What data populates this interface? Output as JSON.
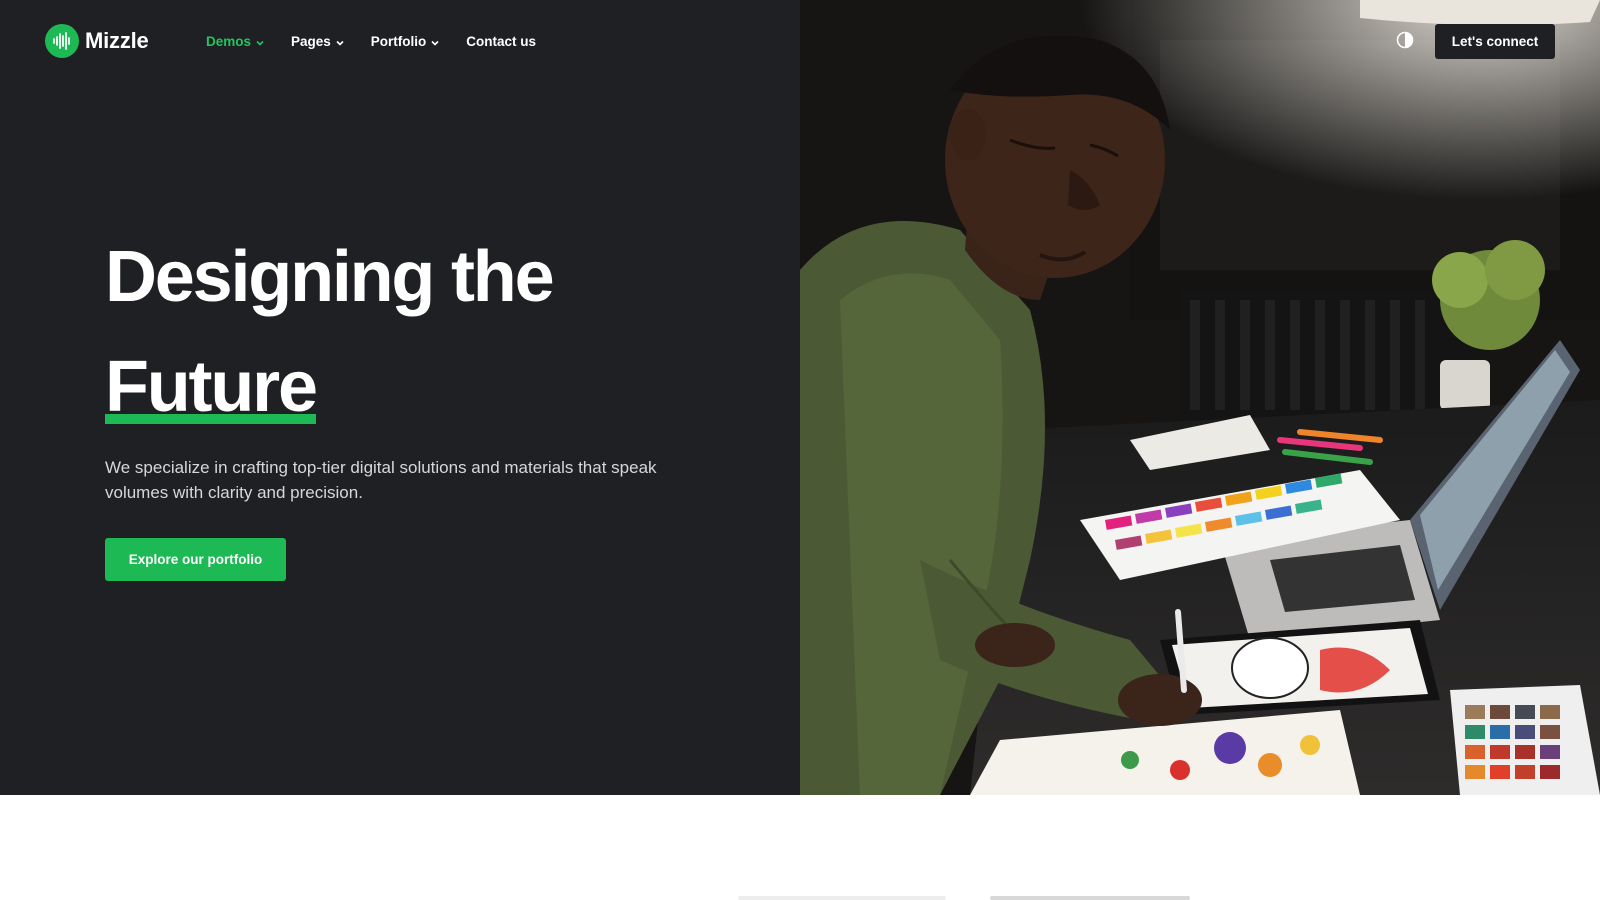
{
  "brand": {
    "name": "Mizzle",
    "logo_icon": "soundwave-icon",
    "accent_color": "#1db954"
  },
  "nav": {
    "items": [
      {
        "label": "Demos",
        "has_dropdown": true,
        "active": true
      },
      {
        "label": "Pages",
        "has_dropdown": true,
        "active": false
      },
      {
        "label": "Portfolio",
        "has_dropdown": true,
        "active": false
      },
      {
        "label": "Contact us",
        "has_dropdown": false,
        "active": false
      }
    ],
    "theme_toggle_icon": "contrast-icon",
    "cta_label": "Let's connect"
  },
  "hero": {
    "headline_line1": "Designing the",
    "headline_line2": "Future",
    "lead": "We specialize in crafting top-tier digital solutions and materials that speak volumes with clarity and precision.",
    "cta_label": "Explore our portfolio",
    "background_color": "#1f2024",
    "image_subject": "designer-drawing-on-tablet-photo"
  }
}
